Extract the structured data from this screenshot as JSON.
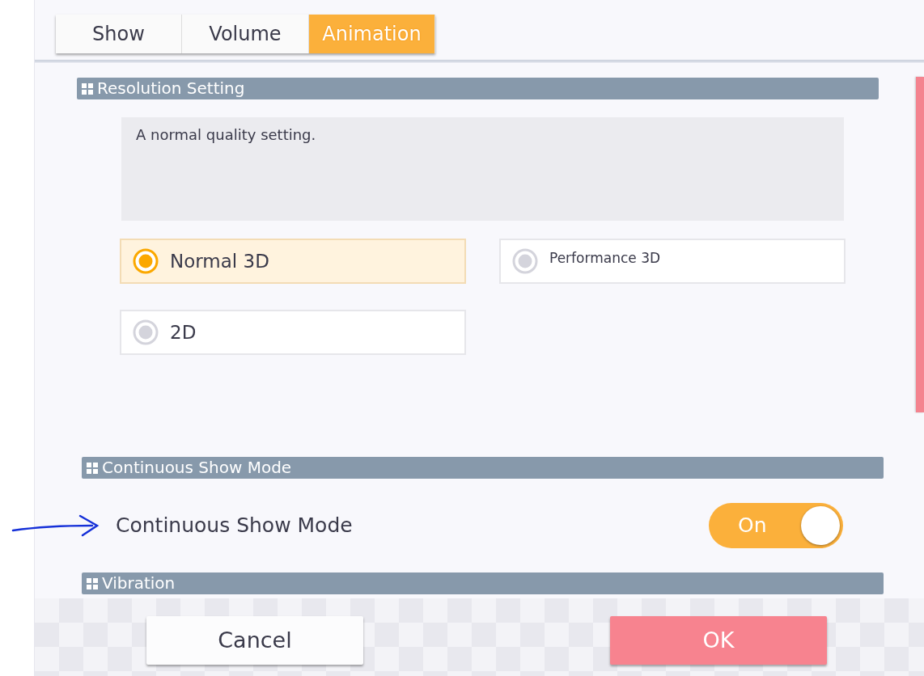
{
  "tabs": [
    {
      "label": "Show",
      "selected": false
    },
    {
      "label": "Volume",
      "selected": false
    },
    {
      "label": "Animation",
      "selected": true
    }
  ],
  "sections": [
    {
      "kind": "options",
      "title": "Resolution Setting",
      "description": "A normal quality setting.",
      "options": [
        {
          "label": "Normal 3D",
          "selected": true
        },
        {
          "label": "Performance 3D",
          "selected": false
        },
        {
          "label": "2D",
          "selected": false
        }
      ]
    },
    {
      "kind": "toggle",
      "title": "Continuous Show Mode",
      "label": "Continuous Show Mode",
      "on": true,
      "state_text": "On"
    },
    {
      "kind": "header",
      "title": "Vibration"
    }
  ],
  "buttons": [
    {
      "label": "Cancel",
      "kind": "secondary"
    },
    {
      "label": "OK",
      "kind": "primary"
    }
  ]
}
